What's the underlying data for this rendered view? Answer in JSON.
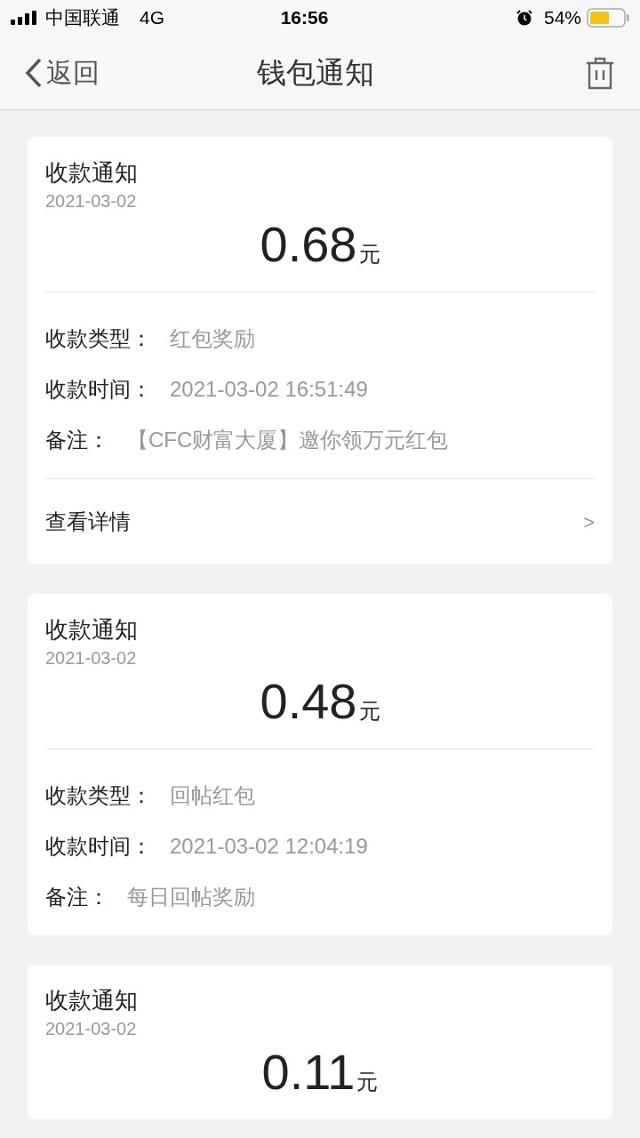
{
  "status_bar": {
    "carrier": "中国联通",
    "network": "4G",
    "time": "16:56",
    "battery": "54%"
  },
  "nav": {
    "back": "返回",
    "title": "钱包通知"
  },
  "cards": [
    {
      "title": "收款通知",
      "date": "2021-03-02",
      "amount": "0.68",
      "unit": "元",
      "rows": [
        {
          "label": "收款类型：",
          "value": "红包奖励"
        },
        {
          "label": "收款时间：",
          "value": "2021-03-02 16:51:49"
        },
        {
          "label": "备注：",
          "value": "【CFC财富大厦】邀你领万元红包"
        }
      ],
      "link": {
        "label": "查看详情",
        "chevron": ">"
      }
    },
    {
      "title": "收款通知",
      "date": "2021-03-02",
      "amount": "0.48",
      "unit": "元",
      "rows": [
        {
          "label": "收款类型：",
          "value": "回帖红包"
        },
        {
          "label": "收款时间：",
          "value": "2021-03-02 12:04:19"
        },
        {
          "label": "备注：",
          "value": "每日回帖奖励"
        }
      ]
    },
    {
      "title": "收款通知",
      "date": "2021-03-02",
      "amount": "0.11",
      "unit": "元"
    }
  ]
}
